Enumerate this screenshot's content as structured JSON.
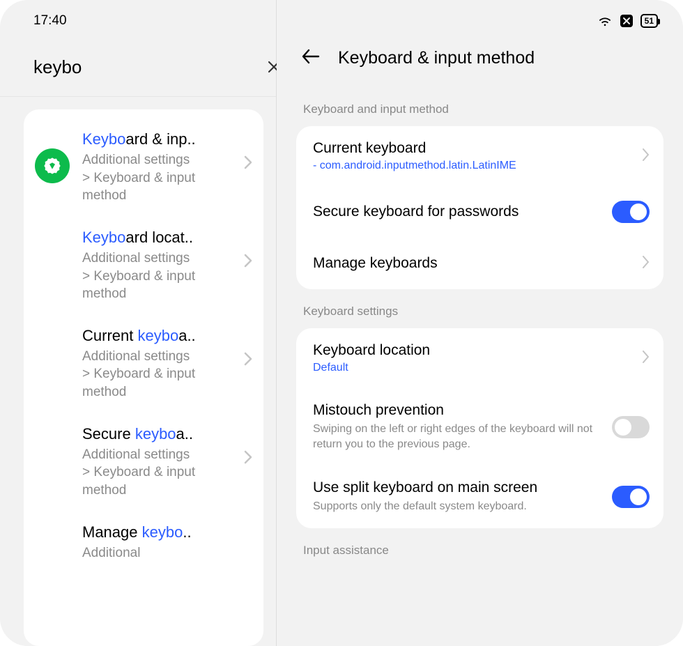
{
  "status": {
    "time": "17:40",
    "battery": "51"
  },
  "search": {
    "value": "keybo",
    "cancel": "Cancel"
  },
  "results": [
    {
      "prefix": "Keybo",
      "suffix": "ard & inp..",
      "path": "Additional settings > Keyboard & input method",
      "hasIcon": true
    },
    {
      "prefix": "Keybo",
      "suffix": "ard locat..",
      "path": "Additional settings > Keyboard & input method",
      "hasIcon": false
    },
    {
      "preText": "Current ",
      "prefix": "keybo",
      "suffix": "a..",
      "path": "Additional settings > Keyboard & input method",
      "hasIcon": false
    },
    {
      "preText": "Secure ",
      "prefix": "keybo",
      "suffix": "a..",
      "path": "Additional settings > Keyboard & input method",
      "hasIcon": false
    },
    {
      "preText": "Manage ",
      "prefix": "keybo",
      "suffix": "..",
      "path": "Additional",
      "hasIcon": false
    }
  ],
  "detail": {
    "title": "Keyboard & input method",
    "sections": {
      "s1": {
        "label": "Keyboard and input method",
        "rows": {
          "current": {
            "title": "Current keyboard",
            "sub": " - com.android.inputmethod.latin.LatinIME"
          },
          "secure": {
            "title": "Secure keyboard for passwords"
          },
          "manage": {
            "title": "Manage keyboards"
          }
        }
      },
      "s2": {
        "label": "Keyboard settings",
        "rows": {
          "location": {
            "title": "Keyboard location",
            "sub": "Default"
          },
          "mistouch": {
            "title": "Mistouch prevention",
            "desc": "Swiping on the left or right edges of the keyboard will not return you to the previous page."
          },
          "split": {
            "title": "Use split keyboard on main screen",
            "desc": "Supports only the default system keyboard."
          }
        }
      },
      "s3": {
        "label": "Input assistance"
      }
    }
  },
  "toggles": {
    "secure": true,
    "mistouch": false,
    "split": true
  }
}
